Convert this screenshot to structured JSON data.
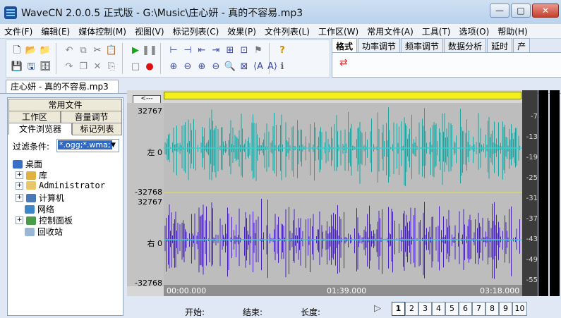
{
  "window": {
    "title": "WaveCN 2.0.0.5 正式版 - G:\\Music\\庄心妍 - 真的不容易.mp3",
    "min": "—",
    "max": "□",
    "close": "✕"
  },
  "menu": [
    "文件(F)",
    "编辑(E)",
    "媒体控制(M)",
    "视图(V)",
    "标记列表(C)",
    "效果(P)",
    "文件列表(L)",
    "工作区(W)",
    "常用文件(A)",
    "工具(T)",
    "选项(O)",
    "帮助(H)"
  ],
  "right_tabs": [
    "格式",
    "功率调节",
    "频率调节",
    "数据分析",
    "延时",
    "产"
  ],
  "right_tab_active": 0,
  "document_tab": "庄心妍 - 真的不容易.mp3",
  "left_panel": {
    "tabs_row1": [
      "常用文件"
    ],
    "tabs_row2": [
      "工作区",
      "音量调节"
    ],
    "tabs_row3": [
      "文件浏览器",
      "标记列表"
    ],
    "filter_label": "过滤条件:",
    "filter_value": "*.ogg;*.wma;",
    "tree": [
      {
        "label": "桌面",
        "icon": "desktop-icon",
        "indent": 0,
        "expander": ""
      },
      {
        "label": "库",
        "icon": "library-icon",
        "indent": 1,
        "expander": "+"
      },
      {
        "label": "Administrator",
        "icon": "user-folder-icon",
        "indent": 1,
        "expander": "+"
      },
      {
        "label": "计算机",
        "icon": "computer-icon",
        "indent": 1,
        "expander": "+"
      },
      {
        "label": "网络",
        "icon": "network-icon",
        "indent": 1,
        "expander": ""
      },
      {
        "label": "控制面板",
        "icon": "control-panel-icon",
        "indent": 1,
        "expander": "+"
      },
      {
        "label": "回收站",
        "icon": "recycle-bin-icon",
        "indent": 1,
        "expander": ""
      }
    ]
  },
  "waveform": {
    "nav_label": "<---",
    "left_channel": {
      "label": "左 0",
      "top": "32767",
      "bottom": "-32768",
      "color": "#18a7a4"
    },
    "right_channel": {
      "label": "右 0",
      "top": "32767",
      "bottom": "-32768",
      "color": "#4a1fc9"
    },
    "time_labels": [
      "00:00.000",
      "01:39.000",
      "03:18.000"
    ]
  },
  "meter": {
    "labels": [
      "-7",
      "-13",
      "-19",
      "-25",
      "-31",
      "-37",
      "-43",
      "-49",
      "-55"
    ]
  },
  "bottom": {
    "start_label": "开始:",
    "end_label": "结束:",
    "length_label": "长度:",
    "play_icon": "▷",
    "pages": [
      "1",
      "2",
      "3",
      "4",
      "5",
      "6",
      "7",
      "8",
      "9",
      "10"
    ],
    "active_page": 0
  },
  "colors": {
    "accent": "#1d4f9b",
    "scroll": "#f4f11a"
  }
}
